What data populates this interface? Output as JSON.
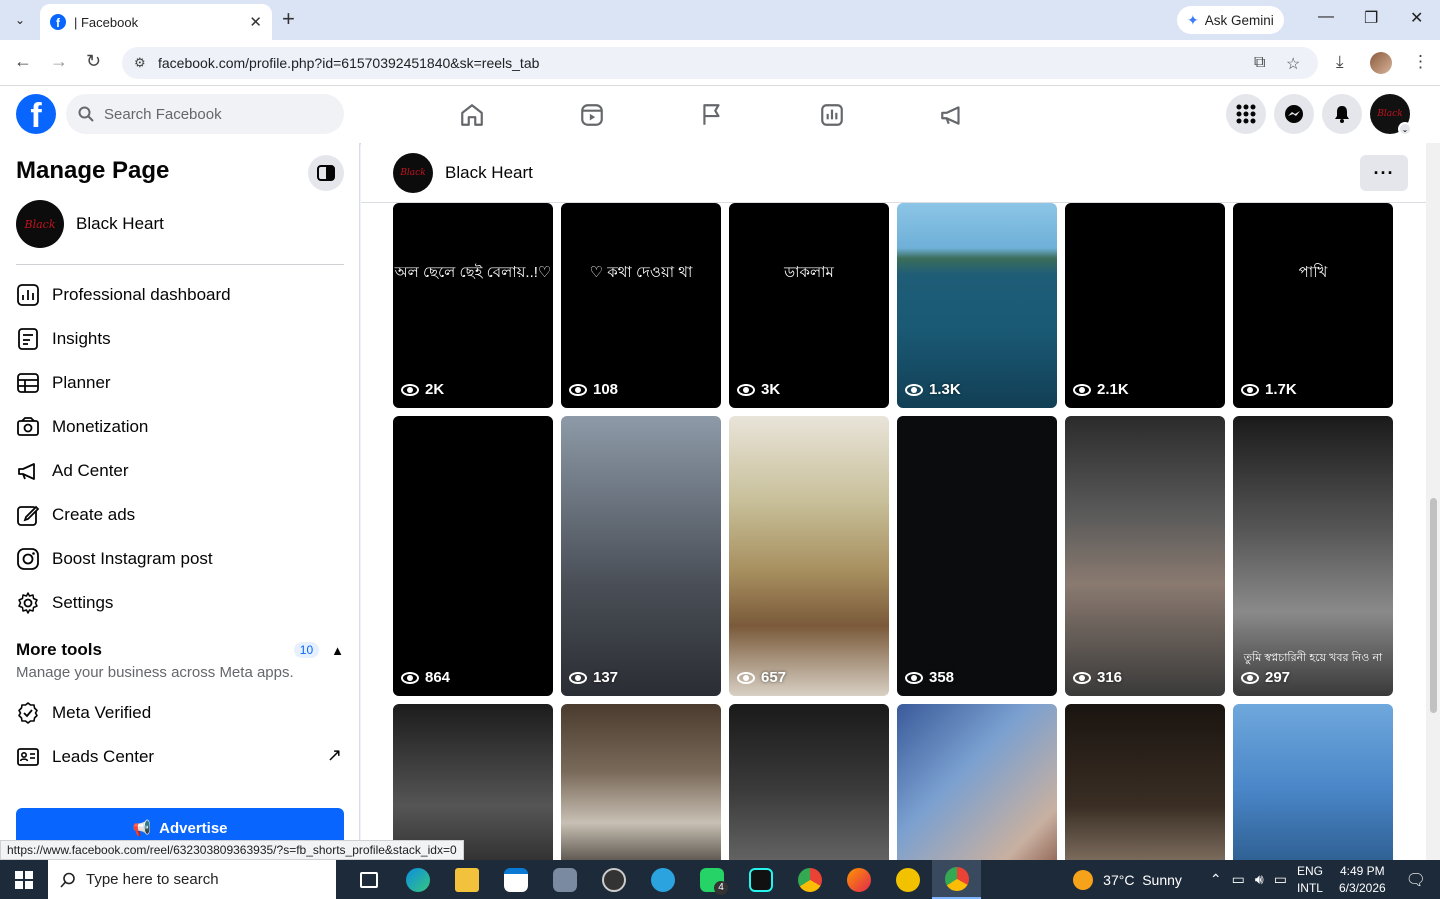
{
  "browser": {
    "tab_title": "| Facebook",
    "gemini_label": "Ask Gemini",
    "url": "facebook.com/profile.php?id=61570392451840&sk=reels_tab",
    "status_url": "https://www.facebook.com/reel/632303809363935/?s=fb_shorts_profile&stack_idx=0"
  },
  "fb": {
    "search_placeholder": "Search Facebook"
  },
  "sidebar": {
    "title": "Manage Page",
    "page_name": "Black Heart",
    "items": [
      {
        "label": "Professional dashboard",
        "icon": "dashboard-icon"
      },
      {
        "label": "Insights",
        "icon": "insights-icon"
      },
      {
        "label": "Planner",
        "icon": "planner-icon"
      },
      {
        "label": "Monetization",
        "icon": "monetization-icon"
      },
      {
        "label": "Ad Center",
        "icon": "megaphone-icon"
      },
      {
        "label": "Create ads",
        "icon": "pencil-icon"
      },
      {
        "label": "Boost Instagram post",
        "icon": "instagram-icon"
      },
      {
        "label": "Settings",
        "icon": "gear-icon"
      }
    ],
    "more_tools": {
      "title": "More tools",
      "count": "10",
      "subtitle": "Manage your business across Meta apps."
    },
    "items2": [
      {
        "label": "Meta Verified",
        "icon": "verified-icon"
      },
      {
        "label": "Leads Center",
        "icon": "leads-icon"
      }
    ],
    "advertise_label": "Advertise"
  },
  "main": {
    "page_name": "Black Heart",
    "reels": [
      {
        "views": "2K",
        "text": "অল ছেলে ছেই বেলায়..!♡",
        "bg": "#000000"
      },
      {
        "views": "108",
        "text": "♡ কথা দেওয়া থা",
        "bg": "#000000"
      },
      {
        "views": "3K",
        "text": "ডাকলাম",
        "bg": "#000000"
      },
      {
        "views": "1.3K",
        "text": "",
        "bg": "linear-gradient(180deg,#8cc5e6 0%,#6fb0d8 22%,#3b6d5a 27%,#1f5d77 35%,#1a5a75 60%,#123f55 100%)"
      },
      {
        "views": "2.1K",
        "text": "",
        "bg": "#000000"
      },
      {
        "views": "1.7K",
        "text": "পাখি",
        "bg": "#000000"
      },
      {
        "views": "864",
        "text": "",
        "bg": "#000000"
      },
      {
        "views": "137",
        "text": "",
        "bg": "linear-gradient(180deg,#8e9aa8 0%,#6b747f 30%,#4a4f57 60%,#2a2d33 100%)"
      },
      {
        "views": "657",
        "text": "",
        "bg": "linear-gradient(180deg,#e9e4da 0%,#c8c09a 30%,#a89060 55%,#7a5a3a 75%,#d8d0c4 100%)"
      },
      {
        "views": "358",
        "text": "",
        "bg": "#0b0c0e"
      },
      {
        "views": "316",
        "text": "",
        "bg": "linear-gradient(180deg,#2b2b2b 0%,#5a5a5a 35%,#8a7a70 60%,#3a3a3a 100%)"
      },
      {
        "views": "297",
        "text": "তুমি স্বপ্নচারিনী হয়ে খবর নিও না",
        "bg": "linear-gradient(180deg,#1a1a1a 0%,#555 40%,#8a8a8a 70%,#3a3a3a 100%)"
      },
      {
        "views": "",
        "text": "",
        "bg": "linear-gradient(180deg,#1c1c1c 0%,#555 60%,#2a2a2a 100%)"
      },
      {
        "views": "",
        "text": "",
        "bg": "linear-gradient(180deg,#4a3b2e 0%,#7a6a5a 40%,#c8c0b4 70%,#3a342e 100%)"
      },
      {
        "views": "",
        "text": "",
        "bg": "linear-gradient(180deg,#1a1a1a 0%,#3a3a3a 50%,#6a6a6a 100%)"
      },
      {
        "views": "",
        "text": "",
        "bg": "linear-gradient(135deg,#3a5a9a 0%,#7aa0d0 40%,#c8b0a0 80%,#8a5a4a 100%)"
      },
      {
        "views": "",
        "text": "",
        "bg": "linear-gradient(180deg,#1a1410 0%,#3a2e24 60%,#8a7a6a 100%)"
      },
      {
        "views": "",
        "text": "",
        "bg": "linear-gradient(180deg,#6fa8dc 0%,#4a86c8 50%,#2a5a8a 100%)"
      }
    ]
  },
  "taskbar": {
    "search_placeholder": "Type here to search",
    "weather": "37°C  Sunny",
    "lang1": "ENG",
    "lang2": "INTL",
    "time": "4:49 PM",
    "date": "6/3/2026",
    "whatsapp_badge": "4"
  }
}
